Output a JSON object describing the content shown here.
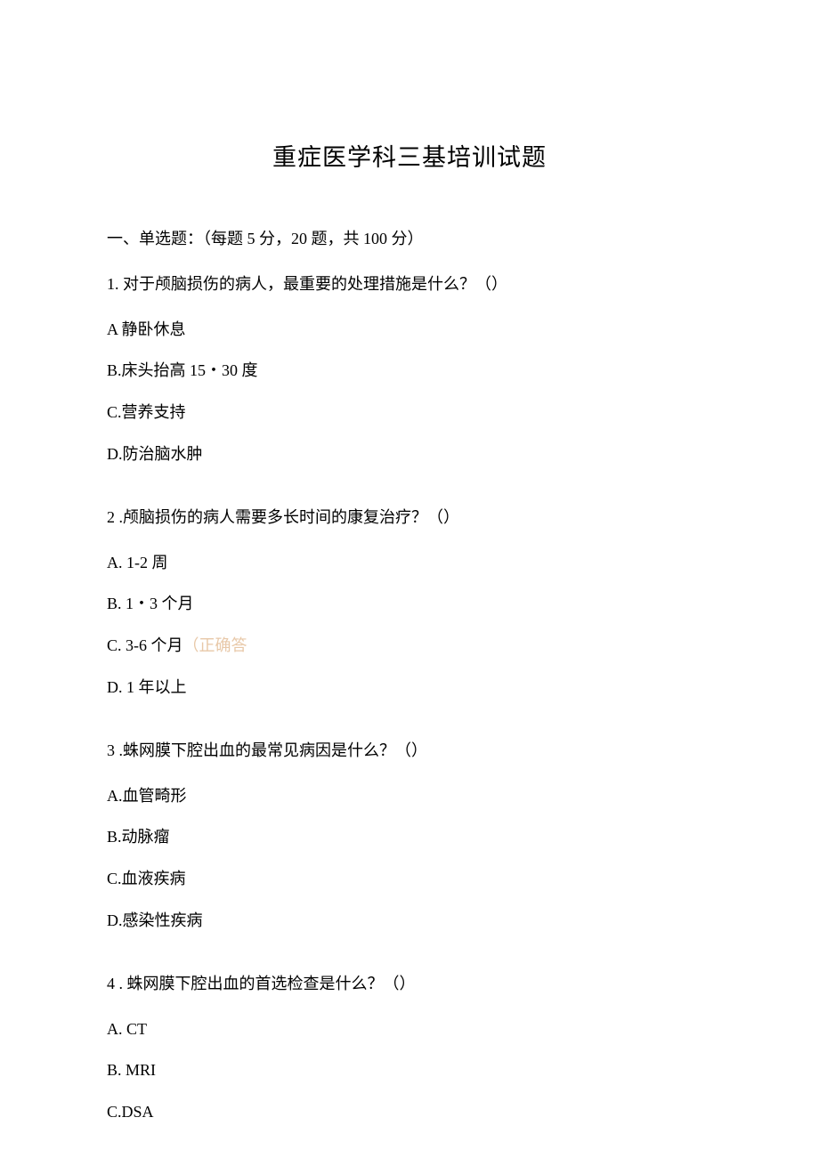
{
  "title": "重症医学科三基培训试题",
  "sectionHeader": "一、单选题：（每题 5 分，20 题，共 100 分）",
  "questions": {
    "q1": {
      "text": "1. 对于颅脑损伤的病人，最重要的处理措施是什么？（）",
      "optA": "A 静卧休息",
      "optB": "B.床头抬高 15・30 度",
      "optC": "C.营养支持",
      "optD": "D.防治脑水肿"
    },
    "q2": {
      "text": "2   .颅脑损伤的病人需要多长时间的康复治疗？（）",
      "optA": "A.   1-2 周",
      "optB": "B.   1・3 个月",
      "optCPrefix": "C.   3-6 个月",
      "optCNote": "（正确答",
      "optD": "D.   1 年以上"
    },
    "q3": {
      "text": "3   .蛛网膜下腔出血的最常见病因是什么？（）",
      "optA": "A.血管畸形",
      "optB": "B.动脉瘤",
      "optC": "C.血液疾病",
      "optD": "D.感染性疾病"
    },
    "q4": {
      "text": "4   . 蛛网膜下腔出血的首选检查是什么？（）",
      "optA": "A.   CT",
      "optB": "B.   MRI",
      "optC": "C.DSA"
    }
  }
}
